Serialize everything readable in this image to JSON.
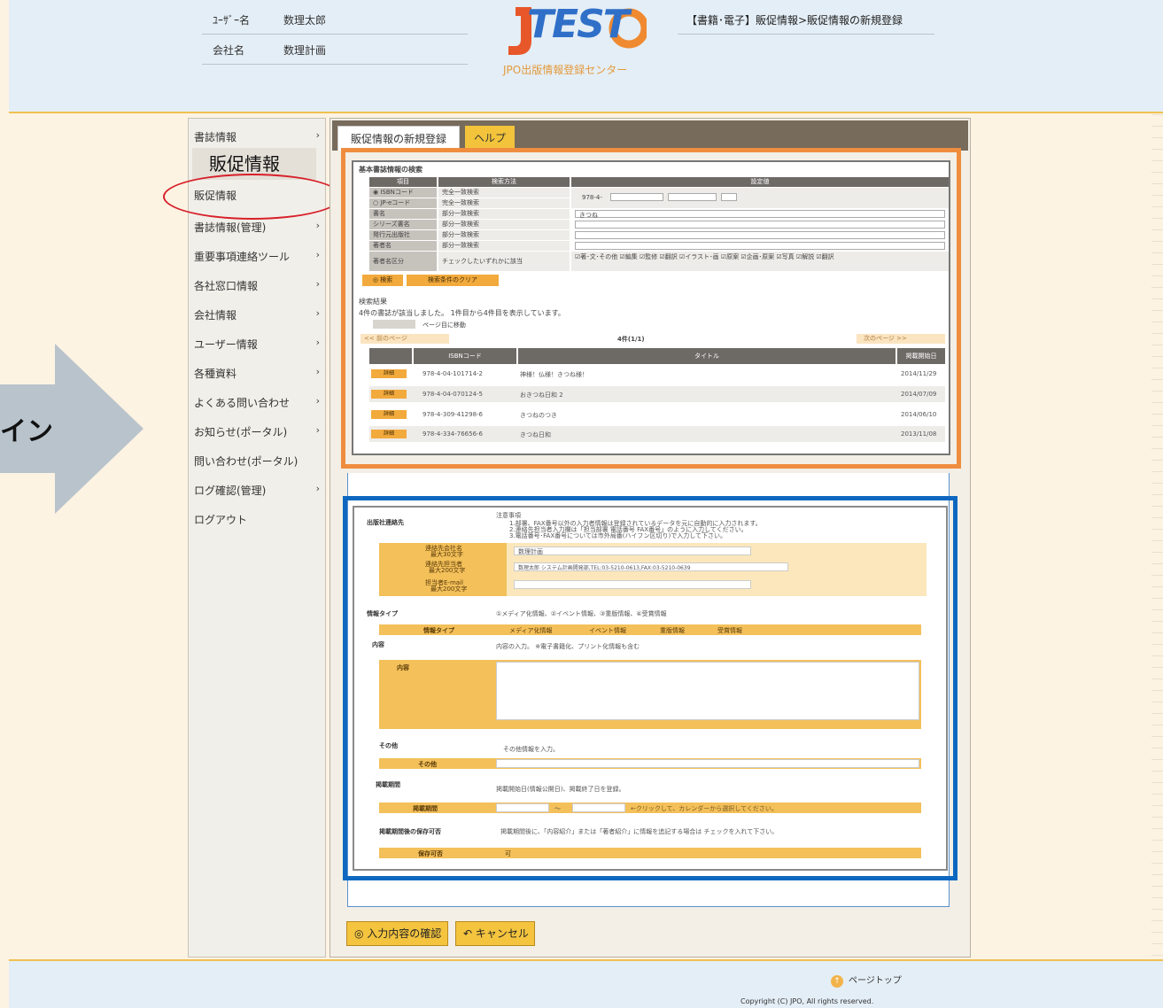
{
  "header": {
    "user_label": "ﾕｰｻﾞｰ名",
    "user_value": "数理太郎",
    "company_label": "会社名",
    "company_value": "数理計画",
    "logo_text": "TEST",
    "logo_subtitle": "JPO出版情報登録センター",
    "breadcrumb": "【書籍･電子】販促情報>販促情報の新規登録"
  },
  "arrow_text": "イン",
  "callout_label": "販促情報",
  "sidebar": {
    "items": [
      {
        "label": "書誌情報",
        "chevron": "›"
      },
      {
        "label": "販促情報",
        "chevron": ""
      },
      {
        "label": "書誌情報(管理)",
        "chevron": "›"
      },
      {
        "label": "重要事項連絡ツール",
        "chevron": "›"
      },
      {
        "label": "各社窓口情報",
        "chevron": "›"
      },
      {
        "label": "会社情報",
        "chevron": "›"
      },
      {
        "label": "ユーザー情報",
        "chevron": "›"
      },
      {
        "label": "各種資料",
        "chevron": "›"
      },
      {
        "label": "よくある問い合わせ",
        "chevron": "›"
      },
      {
        "label": "お知らせ(ポータル)",
        "chevron": "›"
      },
      {
        "label": "問い合わせ(ポータル)",
        "chevron": ""
      },
      {
        "label": "ログ確認(管理)",
        "chevron": "›"
      },
      {
        "label": "ログアウト",
        "chevron": ""
      }
    ]
  },
  "tabs": {
    "active": "販促情報の新規登録",
    "help": "ヘルプ"
  },
  "search": {
    "title": "基本書誌情報の検索",
    "headers": [
      "項目",
      "検索方法",
      "設定値"
    ],
    "rows": [
      {
        "item": "◉ ISBNコード",
        "method": "完全一致検索",
        "value": "978-4-"
      },
      {
        "item": "○ JP-eコード",
        "method": "完全一致検索",
        "value": ""
      },
      {
        "item": "書名",
        "method": "部分一致検索",
        "value": "きつね"
      },
      {
        "item": "シリーズ書名",
        "method": "部分一致検索",
        "value": ""
      },
      {
        "item": "発行元出版社",
        "method": "部分一致検索",
        "value": ""
      },
      {
        "item": "著者名",
        "method": "部分一致検索",
        "value": ""
      },
      {
        "item": "著者名区分",
        "method": "チェックしたいずれかに該当",
        "value": "☑著･文･その他 ☑編集 ☑監修 ☑翻訳 ☑イラスト･画 ☑原案 ☑企画･原案 ☑写真 ☑解説 ☑翻訳"
      }
    ],
    "search_button": "◎ 検索",
    "clear_button": "検索条件のクリア",
    "result_heading": "検索結果",
    "result_message": "4件の書誌が該当しました。 1件目から4件目を表示しています。",
    "page_jump": "ページ目に移動",
    "prev_page": "<< 前のページ",
    "next_page": "次のページ >>",
    "count": "4件(1/1)",
    "result_headers": [
      "ISBNコード",
      "タイトル",
      "掲載開始日"
    ],
    "results": [
      {
        "detail": "詳細",
        "isbn": "978-4-04-101714-2",
        "title": "神様！仏様！きつね様！",
        "date": "2014/11/29"
      },
      {
        "detail": "詳細",
        "isbn": "978-4-04-070124-5",
        "title": "おきつね日和 2",
        "date": "2014/07/09"
      },
      {
        "detail": "詳細",
        "isbn": "978-4-309-41298-6",
        "title": "きつねのつき",
        "date": "2014/06/10"
      },
      {
        "detail": "詳細",
        "isbn": "978-4-334-76656-6",
        "title": "きつね日和",
        "date": "2013/11/08"
      }
    ]
  },
  "form": {
    "publisher_contact_label": "出版社連絡先",
    "note_heading": "注意事項",
    "notes": [
      "1.部署、FAX番号以外の入力者情報は登録されているデータを元に自動的に入力されます。",
      "2.連絡先担当者入力欄は「担当部署 電話番号 FAX番号」のように入力してください。",
      "3.電話番号･FAX番号については市外局番(ハイフン区切り)で入力して下さい。"
    ],
    "company_field_label": "連絡先会社名",
    "company_field_hint": "最大30文字",
    "company_field_value": "数理計画",
    "contact_field_label": "連絡先担当者",
    "contact_field_hint": "最大200文字",
    "contact_field_value": "数理太郎 システム計画開発部,TEL:03-5210-0613,FAX:03-5210-0639",
    "email_field_label": "担当者E-mail",
    "email_field_hint": "最大200文字",
    "info_type_label": "情報タイプ",
    "info_type_text": "①メディア化情報、②イベント情報、③重版情報、④受賞情報",
    "info_type_options": [
      "メディア化情報",
      "イベント情報",
      "重版情報",
      "受賞情報"
    ],
    "content_label": "内容",
    "content_text": "内容の入力。 ※電子書籍化、プリント化情報も含む",
    "content_inner_label": "内容",
    "other_label": "その他",
    "other_text": "その他情報を入力。",
    "period_label": "掲載期間",
    "period_text": "掲載開始日(情報公開日)、掲載終了日を登録。",
    "period_hint": "←クリックして、カレンダーから選択してください。",
    "after_label": "掲載期間後の保存可否",
    "after_text": "掲載期間後に、「内容紹介」または「著者紹介」に情報を追記する場合は チェックを入れて下さい。",
    "save_label": "保存可否",
    "save_option": "可"
  },
  "buttons": {
    "confirm": "◎ 入力内容の確認",
    "cancel": "↶ キャンセル"
  },
  "footer": {
    "page_top": "ページトップ",
    "copyright": "Copyright (C) JPO, All rights reserved."
  },
  "colors": {
    "orange_highlight": "#ef8d3f",
    "blue_highlight": "#0f68c0",
    "accent_yellow": "#f4c43f",
    "callout_ring": "#d8202a"
  }
}
